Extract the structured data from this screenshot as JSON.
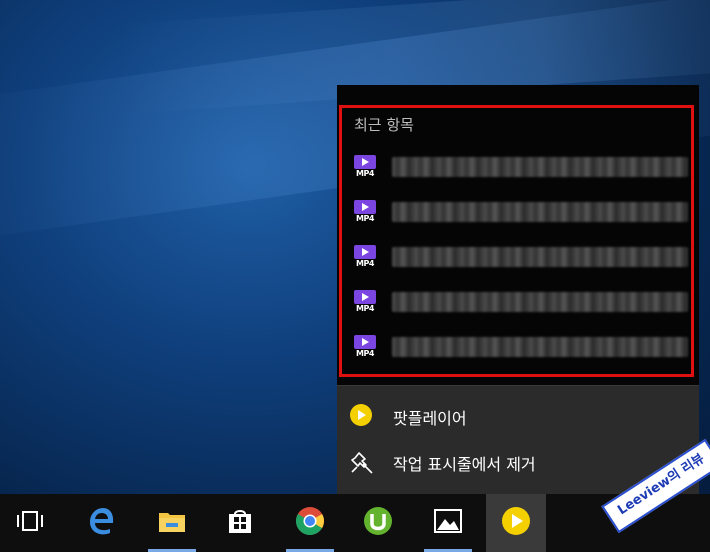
{
  "jumplist": {
    "section_title": "최근 항목",
    "recent_items": [
      {
        "icon": "mp4-file-icon",
        "badge": "MP4"
      },
      {
        "icon": "mp4-file-icon",
        "badge": "MP4"
      },
      {
        "icon": "mp4-file-icon",
        "badge": "MP4"
      },
      {
        "icon": "mp4-file-icon",
        "badge": "MP4"
      },
      {
        "icon": "mp4-file-icon",
        "badge": "MP4"
      }
    ],
    "actions": [
      {
        "icon": "potplayer-icon",
        "label": "팟플레이어"
      },
      {
        "icon": "unpin-icon",
        "label": "작업 표시줄에서 제거"
      }
    ]
  },
  "taskbar": {
    "buttons": [
      {
        "name": "task-view",
        "icon": "task-view-icon",
        "active": false,
        "running": false
      },
      {
        "name": "edge",
        "icon": "edge-icon",
        "active": false,
        "running": false
      },
      {
        "name": "file-explorer",
        "icon": "folder-icon",
        "active": false,
        "running": true
      },
      {
        "name": "store",
        "icon": "store-icon",
        "active": false,
        "running": false
      },
      {
        "name": "chrome",
        "icon": "chrome-icon",
        "active": false,
        "running": true
      },
      {
        "name": "utorrent",
        "icon": "utorrent-icon",
        "active": false,
        "running": false
      },
      {
        "name": "photos",
        "icon": "photos-icon",
        "active": false,
        "running": true
      },
      {
        "name": "potplayer",
        "icon": "potplayer-icon",
        "active": true,
        "running": false
      }
    ]
  },
  "watermark": {
    "text": "Leeview의 리뷰"
  },
  "colors": {
    "highlight": "#e01010",
    "accent": "#78a9e6",
    "mp4_badge": "#7a45e0",
    "potplayer": "#f5d000"
  }
}
